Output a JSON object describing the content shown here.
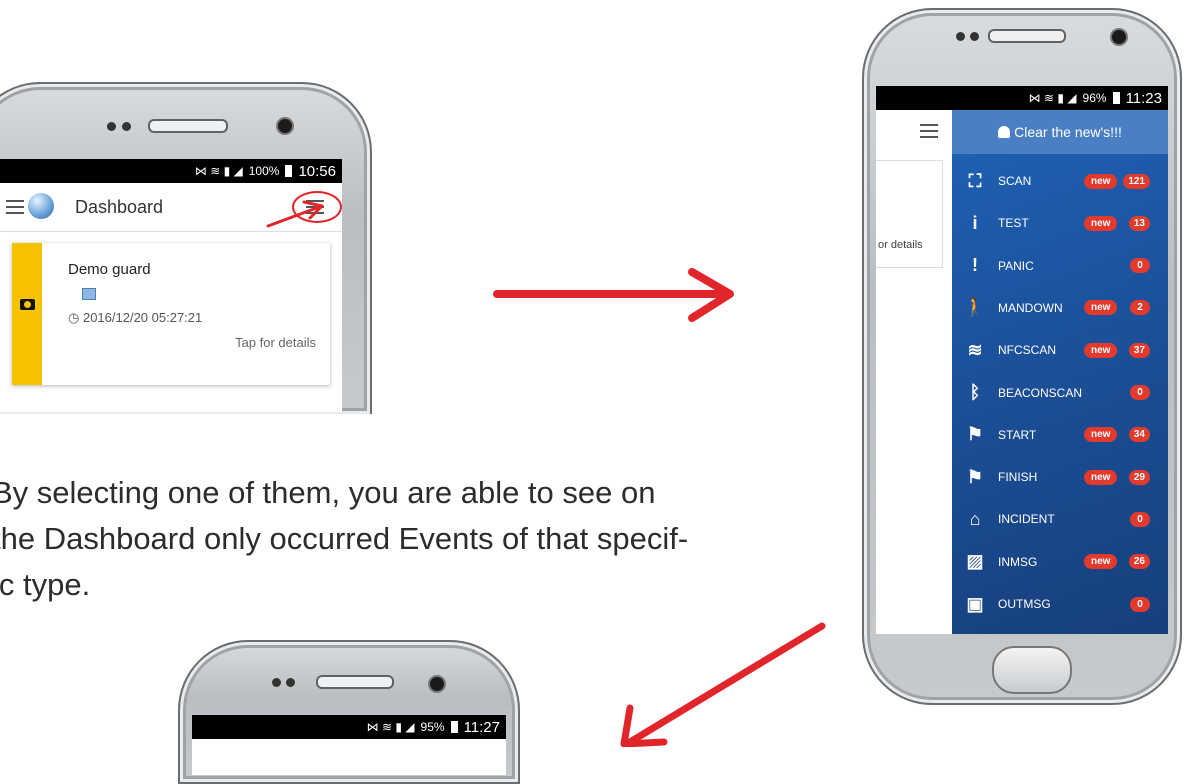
{
  "phone1": {
    "status": {
      "signal_pct": "100%",
      "time": "10:56"
    },
    "title": "Dashboard",
    "card": {
      "name": "Demo guard",
      "timestamp": "2016/12/20 05:27:21",
      "tap_hint": "Tap for details"
    }
  },
  "phone2": {
    "status": {
      "signal_pct": "96%",
      "time": "11:23"
    },
    "left_card_hint": "or details",
    "drawer_header": "Clear the new's!!!",
    "items": [
      {
        "icon": "scan-icon",
        "label": "SCAN",
        "new": "new",
        "count": "121"
      },
      {
        "icon": "info-icon",
        "label": "TEST",
        "new": "new",
        "count": "13"
      },
      {
        "icon": "exclamation-icon",
        "label": "PANIC",
        "new": "",
        "count": "0"
      },
      {
        "icon": "person-walking-icon",
        "label": "MANDOWN",
        "new": "new",
        "count": "2"
      },
      {
        "icon": "wifi-icon",
        "label": "NFCSCAN",
        "new": "new",
        "count": "37"
      },
      {
        "icon": "bluetooth-icon",
        "label": "BEACONSCAN",
        "new": "",
        "count": "0"
      },
      {
        "icon": "flag-icon",
        "label": "START",
        "new": "new",
        "count": "34"
      },
      {
        "icon": "flag-icon",
        "label": "FINISH",
        "new": "new",
        "count": "29"
      },
      {
        "icon": "home-icon",
        "label": "INCIDENT",
        "new": "",
        "count": "0"
      },
      {
        "icon": "image-icon",
        "label": "INMSG",
        "new": "new",
        "count": "26"
      },
      {
        "icon": "message-icon",
        "label": "OUTMSG",
        "new": "",
        "count": "0"
      }
    ]
  },
  "phone3": {
    "status": {
      "signal_pct": "95%",
      "time": "11:27"
    }
  },
  "caption": [
    "By selecting one of them, you are able to see on",
    "the Dashboard only occurred Events of that specif-",
    "ic type."
  ],
  "colors": {
    "arrow": "#e1262b",
    "drawer_blue": "#1f62b6",
    "badge_red": "#e23b2e",
    "card_accent": "#f6c200"
  }
}
